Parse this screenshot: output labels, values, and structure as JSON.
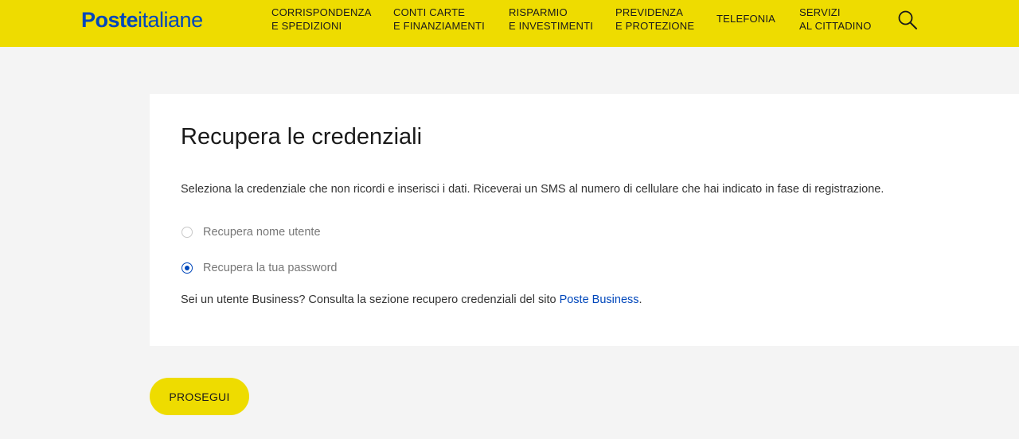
{
  "header": {
    "logo_bold": "Poste",
    "logo_light": "italiane",
    "nav": [
      {
        "line1": "CORRISPONDENZA",
        "line2": "E SPEDIZIONI"
      },
      {
        "line1": "CONTI CARTE",
        "line2": "E FINANZIAMENTI"
      },
      {
        "line1": "RISPARMIO",
        "line2": "E INVESTIMENTI"
      },
      {
        "line1": "PREVIDENZA",
        "line2": "E PROTEZIONE"
      },
      {
        "line1": "TELEFONIA",
        "line2": ""
      },
      {
        "line1": "SERVIZI",
        "line2": "AL CITTADINO"
      }
    ],
    "search_icon": "search-icon"
  },
  "main": {
    "title": "Recupera le credenziali",
    "description": "Seleziona la credenziale che non ricordi e inserisci i dati. Riceverai un SMS al numero di cellulare che hai indicato in fase di registrazione.",
    "options": [
      {
        "label": "Recupera nome utente",
        "checked": false
      },
      {
        "label": "Recupera la tua password",
        "checked": true
      }
    ],
    "business_text": "Sei un utente Business? Consulta la sezione recupero credenziali del sito ",
    "business_link": "Poste Business",
    "business_end": ".",
    "submit_label": "PROSEGUI"
  },
  "colors": {
    "brand_yellow": "#eedc00",
    "brand_blue": "#0047bb",
    "background": "#f4f4f4"
  }
}
